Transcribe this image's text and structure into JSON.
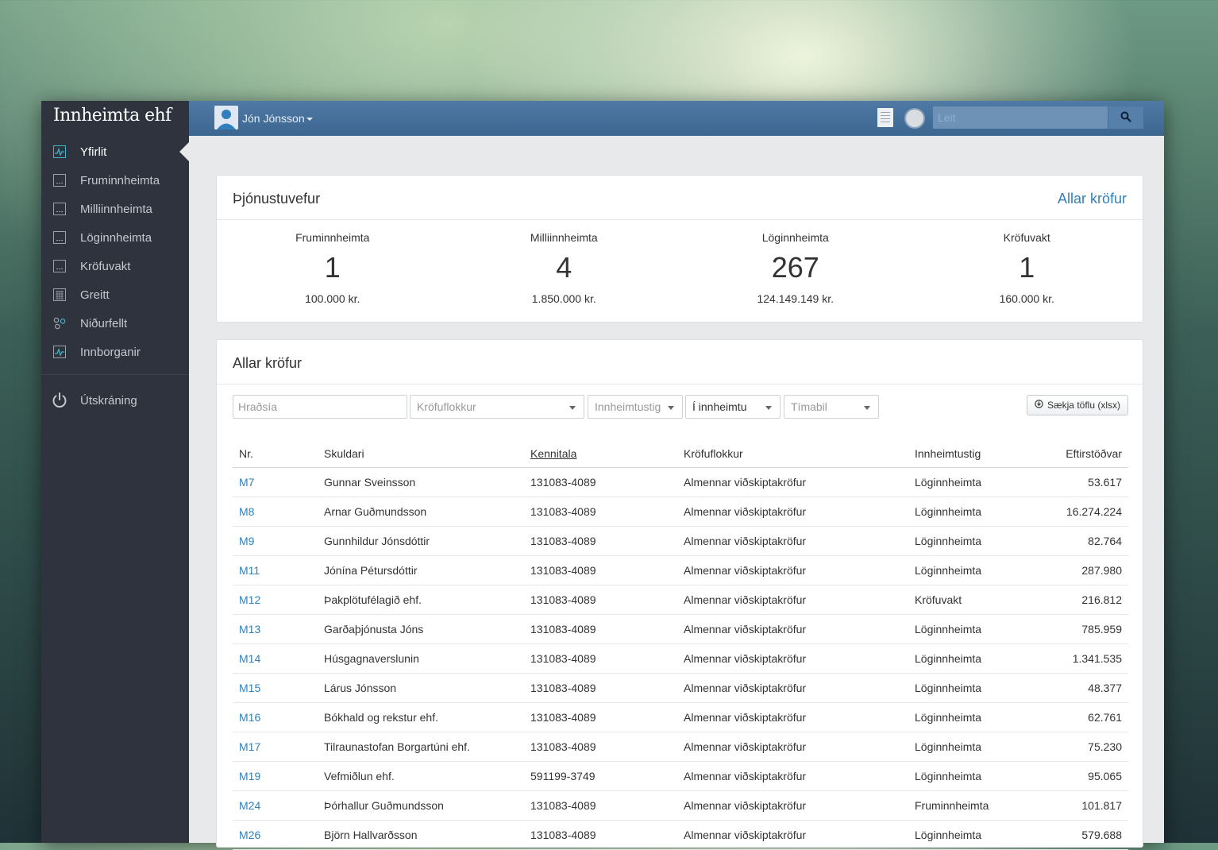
{
  "brand": "Innheimta ehf",
  "sidebar": {
    "items": [
      {
        "label": "Yfirlit",
        "icon": "activity-icon",
        "active": true
      },
      {
        "label": "Fruminnheimta",
        "icon": "document-icon"
      },
      {
        "label": "Milliinnheimta",
        "icon": "document-icon"
      },
      {
        "label": "Löginnheimta",
        "icon": "document-icon"
      },
      {
        "label": "Kröfuvakt",
        "icon": "document-icon"
      },
      {
        "label": "Greitt",
        "icon": "grid-icon"
      },
      {
        "label": "Niðurfellt",
        "icon": "nodes-icon"
      },
      {
        "label": "Innborganir",
        "icon": "activity-icon"
      }
    ],
    "logout_label": "Útskráning"
  },
  "topbar": {
    "user_name": "Jón Jónsson",
    "search_placeholder": "Leit"
  },
  "overview": {
    "title": "Þjónustuvefur",
    "link": "Allar kröfur",
    "stats": [
      {
        "label": "Fruminnheimta",
        "count": "1",
        "amount": "100.000 kr."
      },
      {
        "label": "Milliinnheimta",
        "count": "4",
        "amount": "1.850.000 kr."
      },
      {
        "label": "Löginnheimta",
        "count": "267",
        "amount": "124.149.149 kr."
      },
      {
        "label": "Kröfuvakt",
        "count": "1",
        "amount": "160.000 kr."
      }
    ]
  },
  "claims": {
    "title": "Allar kröfur",
    "filters": {
      "quick_search_placeholder": "Hraðsía",
      "category": "Kröfuflokkur",
      "stage": "Innheimtustig",
      "status": "Í innheimtu",
      "period": "Tímabil"
    },
    "download_label": "Sækja töflu (xlsx)",
    "columns": [
      "Nr.",
      "Skuldari",
      "Kennitala",
      "Kröfuflokkur",
      "Innheimtustig",
      "Eftirstöðvar"
    ],
    "rows": [
      [
        "M7",
        "Gunnar Sveinsson",
        "131083-4089",
        "Almennar viðskiptakröfur",
        "Löginnheimta",
        "53.617"
      ],
      [
        "M8",
        "Arnar Guðmundsson",
        "131083-4089",
        "Almennar viðskiptakröfur",
        "Löginnheimta",
        "16.274.224"
      ],
      [
        "M9",
        "Gunnhildur Jónsdóttir",
        "131083-4089",
        "Almennar viðskiptakröfur",
        "Löginnheimta",
        "82.764"
      ],
      [
        "M11",
        "Jónína Pétursdóttir",
        "131083-4089",
        "Almennar viðskiptakröfur",
        "Löginnheimta",
        "287.980"
      ],
      [
        "M12",
        "Þakplötufélagið ehf.",
        "131083-4089",
        "Almennar viðskiptakröfur",
        "Kröfuvakt",
        "216.812"
      ],
      [
        "M13",
        "Garðaþjónusta Jóns",
        "131083-4089",
        "Almennar viðskiptakröfur",
        "Löginnheimta",
        "785.959"
      ],
      [
        "M14",
        "Húsgagnaverslunin",
        "131083-4089",
        "Almennar viðskiptakröfur",
        "Löginnheimta",
        "1.341.535"
      ],
      [
        "M15",
        "Lárus Jónsson",
        "131083-4089",
        "Almennar viðskiptakröfur",
        "Löginnheimta",
        "48.377"
      ],
      [
        "M16",
        "Bókhald og rekstur ehf.",
        "131083-4089",
        "Almennar viðskiptakröfur",
        "Löginnheimta",
        "62.761"
      ],
      [
        "M17",
        "Tilraunastofan Borgartúni ehf.",
        "131083-4089",
        "Almennar viðskiptakröfur",
        "Löginnheimta",
        "75.230"
      ],
      [
        "M19",
        "Vefmiðlun ehf.",
        "591199-3749",
        "Almennar viðskiptakröfur",
        "Löginnheimta",
        "95.065"
      ],
      [
        "M24",
        "Þórhallur Guðmundsson",
        "131083-4089",
        "Almennar viðskiptakröfur",
        "Fruminnheimta",
        "101.817"
      ],
      [
        "M26",
        "Björn Hallvarðsson",
        "131083-4089",
        "Almennar viðskiptakröfur",
        "Löginnheimta",
        "579.688"
      ]
    ]
  }
}
